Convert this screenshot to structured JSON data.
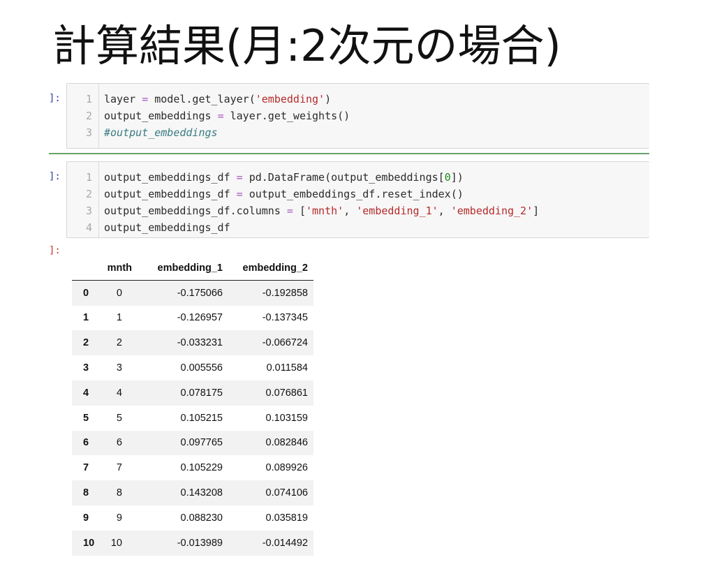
{
  "slide": {
    "title": "計算結果(月:2次元の場合)"
  },
  "cells": [
    {
      "prompt": "]:",
      "lines": [
        {
          "num": "1",
          "tokens": [
            {
              "t": "layer ",
              "c": ""
            },
            {
              "t": "=",
              "c": "op"
            },
            {
              "t": " model.get_layer(",
              "c": ""
            },
            {
              "t": "'embedding'",
              "c": "str"
            },
            {
              "t": ")",
              "c": ""
            }
          ]
        },
        {
          "num": "2",
          "tokens": [
            {
              "t": "output_embeddings ",
              "c": ""
            },
            {
              "t": "=",
              "c": "op"
            },
            {
              "t": " layer.get_weights()",
              "c": ""
            }
          ]
        },
        {
          "num": "3",
          "tokens": [
            {
              "t": "#output_embeddings",
              "c": "cmt"
            }
          ]
        }
      ]
    },
    {
      "prompt": "]:",
      "lines": [
        {
          "num": "1",
          "tokens": [
            {
              "t": "output_embeddings_df ",
              "c": ""
            },
            {
              "t": "=",
              "c": "op"
            },
            {
              "t": " pd.DataFrame(output_embeddings[",
              "c": ""
            },
            {
              "t": "0",
              "c": "num"
            },
            {
              "t": "])",
              "c": ""
            }
          ]
        },
        {
          "num": "2",
          "tokens": [
            {
              "t": "output_embeddings_df ",
              "c": ""
            },
            {
              "t": "=",
              "c": "op"
            },
            {
              "t": " output_embeddings_df.reset_index()",
              "c": ""
            }
          ]
        },
        {
          "num": "3",
          "tokens": [
            {
              "t": "output_embeddings_df.columns ",
              "c": ""
            },
            {
              "t": "=",
              "c": "op"
            },
            {
              "t": " [",
              "c": ""
            },
            {
              "t": "'mnth'",
              "c": "str"
            },
            {
              "t": ", ",
              "c": ""
            },
            {
              "t": "'embedding_1'",
              "c": "str"
            },
            {
              "t": ", ",
              "c": ""
            },
            {
              "t": "'embedding_2'",
              "c": "str"
            },
            {
              "t": "]",
              "c": ""
            }
          ]
        },
        {
          "num": "4",
          "tokens": [
            {
              "t": "output_embeddings_df",
              "c": ""
            }
          ]
        }
      ]
    }
  ],
  "output": {
    "prompt": "]:",
    "columns": [
      "mnth",
      "embedding_1",
      "embedding_2"
    ],
    "rows": [
      {
        "idx": "0",
        "mnth": "0",
        "e1": "-0.175066",
        "e2": "-0.192858"
      },
      {
        "idx": "1",
        "mnth": "1",
        "e1": "-0.126957",
        "e2": "-0.137345"
      },
      {
        "idx": "2",
        "mnth": "2",
        "e1": "-0.033231",
        "e2": "-0.066724"
      },
      {
        "idx": "3",
        "mnth": "3",
        "e1": "0.005556",
        "e2": "0.011584"
      },
      {
        "idx": "4",
        "mnth": "4",
        "e1": "0.078175",
        "e2": "0.076861"
      },
      {
        "idx": "5",
        "mnth": "5",
        "e1": "0.105215",
        "e2": "0.103159"
      },
      {
        "idx": "6",
        "mnth": "6",
        "e1": "0.097765",
        "e2": "0.082846"
      },
      {
        "idx": "7",
        "mnth": "7",
        "e1": "0.105229",
        "e2": "0.089926"
      },
      {
        "idx": "8",
        "mnth": "8",
        "e1": "0.143208",
        "e2": "0.074106"
      },
      {
        "idx": "9",
        "mnth": "9",
        "e1": "0.088230",
        "e2": "0.035819"
      },
      {
        "idx": "10",
        "mnth": "10",
        "e1": "-0.013989",
        "e2": "-0.014492"
      }
    ]
  }
}
